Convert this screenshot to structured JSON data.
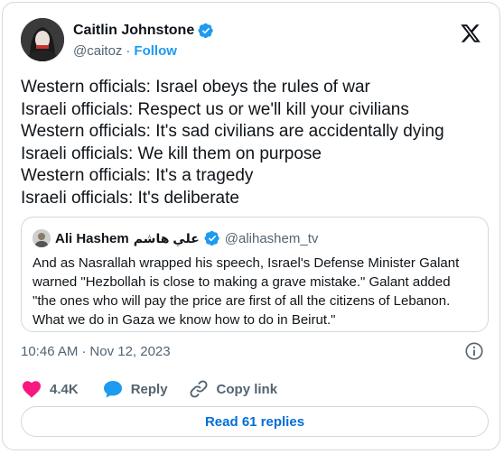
{
  "author": {
    "name": "Caitlin Johnstone",
    "handle": "@caitoz",
    "separator": "·",
    "follow_label": "Follow"
  },
  "tweet_lines": [
    "Western officials: Israel obeys the rules of war",
    "Israeli officials: Respect us or we'll kill your civilians",
    "Western officials: It's sad civilians are accidentally dying",
    "Israeli officials: We kill them on purpose",
    "Western officials: It's a tragedy",
    "Israeli officials: It's deliberate"
  ],
  "quote": {
    "name": "Ali Hashem",
    "name_arabic": "علي هاشم",
    "handle": "@alihashem_tv",
    "lines": [
      "And as Nasrallah wrapped his speech, Israel's Defense Minister Galant",
      "warned \"Hezbollah is close to making a grave mistake.\" Galant added",
      "\"the ones who will pay the price are first of all the citizens of Lebanon.",
      "What we do in Gaza we know how to do in Beirut.\""
    ]
  },
  "meta": {
    "time": "10:46 AM",
    "separator": "·",
    "date": "Nov 12, 2023"
  },
  "actions": {
    "like_count": "4.4K",
    "reply_label": "Reply",
    "copy_label": "Copy link"
  },
  "read_replies_label": "Read 61 replies",
  "colors": {
    "accent": "#1d9bf0",
    "like": "#f91880",
    "text": "#0f1419",
    "secondary": "#536471",
    "border": "#cfd9de"
  },
  "icons": [
    "verified-badge-icon",
    "x-logo-icon",
    "info-icon",
    "heart-icon",
    "reply-bubble-icon",
    "link-icon"
  ]
}
